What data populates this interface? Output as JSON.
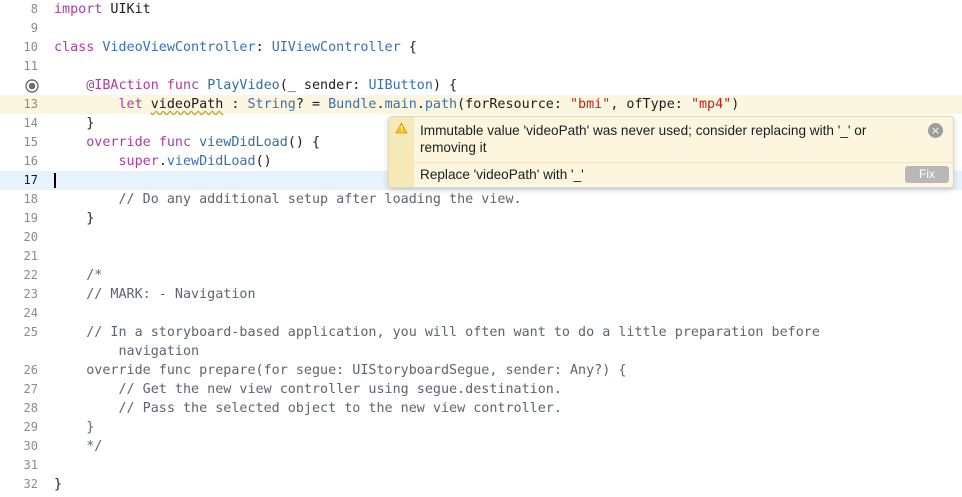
{
  "editor": {
    "lines": [
      {
        "n": "8",
        "segs": [
          [
            "kw",
            "import"
          ],
          [
            "plain",
            " UIKit"
          ]
        ]
      },
      {
        "n": "9",
        "segs": []
      },
      {
        "n": "10",
        "segs": [
          [
            "kw",
            "class"
          ],
          [
            "plain",
            " "
          ],
          [
            "ty",
            "VideoViewController"
          ],
          [
            "plain",
            ": "
          ],
          [
            "ty",
            "UIViewController"
          ],
          [
            "plain",
            " {"
          ]
        ]
      },
      {
        "n": "11",
        "segs": []
      },
      {
        "n": "",
        "segs": [
          [
            "plain",
            "    "
          ],
          [
            "kw",
            "@IBAction"
          ],
          [
            "plain",
            " "
          ],
          [
            "kw",
            "func"
          ],
          [
            "plain",
            " "
          ],
          [
            "fn",
            "PlayVideo"
          ],
          [
            "plain",
            "(_ sender: "
          ],
          [
            "ty",
            "UIButton"
          ],
          [
            "plain",
            ") {"
          ]
        ]
      },
      {
        "n": "13",
        "segs": [
          [
            "plain",
            "        "
          ],
          [
            "kw",
            "let"
          ],
          [
            "plain",
            " "
          ],
          [
            "sq",
            "videoPath"
          ],
          [
            "plain",
            " : "
          ],
          [
            "ty",
            "String"
          ],
          [
            "plain",
            "? = "
          ],
          [
            "ty",
            "Bundle"
          ],
          [
            "plain",
            "."
          ],
          [
            "ty",
            "main"
          ],
          [
            "plain",
            "."
          ],
          [
            "ty",
            "path"
          ],
          [
            "plain",
            "(forResource: "
          ],
          [
            "str",
            "\"bmi\""
          ],
          [
            "plain",
            ", ofType: "
          ],
          [
            "str",
            "\"mp4\""
          ],
          [
            "plain",
            ")"
          ]
        ]
      },
      {
        "n": "14",
        "segs": [
          [
            "plain",
            "    }"
          ]
        ]
      },
      {
        "n": "15",
        "segs": [
          [
            "plain",
            "    "
          ],
          [
            "kw",
            "override"
          ],
          [
            "plain",
            " "
          ],
          [
            "kw",
            "func"
          ],
          [
            "plain",
            " "
          ],
          [
            "fn",
            "viewDidLoad"
          ],
          [
            "plain",
            "() {"
          ]
        ]
      },
      {
        "n": "16",
        "segs": [
          [
            "plain",
            "        "
          ],
          [
            "kw",
            "super"
          ],
          [
            "plain",
            "."
          ],
          [
            "ty",
            "viewDidLoad"
          ],
          [
            "plain",
            "()"
          ]
        ]
      },
      {
        "n": "17",
        "segs": []
      },
      {
        "n": "18",
        "segs": [
          [
            "cm",
            "        // Do any additional setup after loading the view."
          ]
        ]
      },
      {
        "n": "19",
        "segs": [
          [
            "plain",
            "    }"
          ]
        ]
      },
      {
        "n": "20",
        "segs": []
      },
      {
        "n": "21",
        "segs": []
      },
      {
        "n": "22",
        "segs": [
          [
            "cm",
            "    /*"
          ]
        ]
      },
      {
        "n": "23",
        "segs": [
          [
            "cm",
            "    // MARK: - Navigation"
          ]
        ]
      },
      {
        "n": "24",
        "segs": []
      },
      {
        "n": "25",
        "segs": [
          [
            "cm",
            "    // In a storyboard-based application, you will often want to do a little preparation before"
          ]
        ]
      },
      {
        "n": "",
        "segs": [
          [
            "cm",
            "        navigation"
          ]
        ]
      },
      {
        "n": "26",
        "segs": [
          [
            "cm",
            "    override func prepare(for segue: UIStoryboardSegue, sender: Any?) {"
          ]
        ]
      },
      {
        "n": "27",
        "segs": [
          [
            "cm",
            "        // Get the new view controller using segue.destination."
          ]
        ]
      },
      {
        "n": "28",
        "segs": [
          [
            "cm",
            "        // Pass the selected object to the new view controller."
          ]
        ]
      },
      {
        "n": "29",
        "segs": [
          [
            "cm",
            "    }"
          ]
        ]
      },
      {
        "n": "30",
        "segs": [
          [
            "cm",
            "    */"
          ]
        ]
      },
      {
        "n": "31",
        "segs": []
      },
      {
        "n": "32",
        "segs": [
          [
            "plain",
            "}"
          ]
        ]
      }
    ]
  },
  "warning": {
    "message": "Immutable value 'videoPath' was never used; consider replacing with '_' or removing it",
    "fix_description": "Replace 'videoPath' with '_'",
    "fix_label": "Fix",
    "close_symbol": "×",
    "icon": "warning-triangle-icon"
  },
  "colors": {
    "keyword": "#a83fa1",
    "type": "#3d6fb0",
    "string": "#c4221b",
    "comment": "#5c6670",
    "warning_bg": "#fcf6df",
    "current_line": "#e8f2fe"
  }
}
